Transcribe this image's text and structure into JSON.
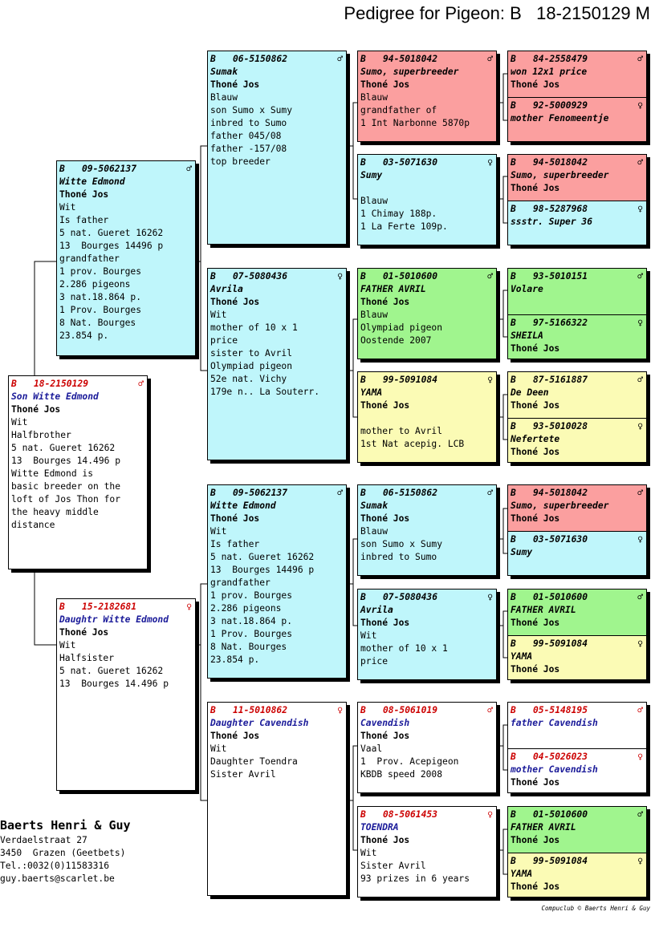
{
  "title": "Pedigree for Pigeon: B   18-2150129 M",
  "subject": {
    "cc": "B",
    "ring": "18-2150129",
    "sex": "♂",
    "name": "Son Witte Edmond",
    "owner": "Thoné Jos",
    "lines": [
      "Wit",
      "Halfbrother",
      "5 nat. Gueret 16262",
      "13  Bourges 14.496 p",
      "Witte Edmond is",
      "basic breeder on the",
      "loft of Jos Thon for",
      "the heavy middle",
      "distance"
    ]
  },
  "sibling": {
    "cc": "B",
    "ring": "15-2182681",
    "sex": "♀",
    "name": "Daughtr Witte Edmond",
    "owner": "Thoné Jos",
    "lines": [
      "Wit",
      "Halfsister",
      "5 nat. Gueret 16262",
      "13  Bourges 14.496 p"
    ]
  },
  "p1": {
    "cc": "B",
    "ring": "09-5062137",
    "sex": "♂",
    "name": "Witte Edmond",
    "owner": "Thoné Jos",
    "lines": [
      "Wit",
      "Is father",
      "5 nat. Gueret 16262",
      "13  Bourges 14496 p",
      "grandfather",
      "1 prov. Bourges",
      "2.286 pigeons",
      "3 nat.18.864 p.",
      "1 Prov. Bourges",
      "8 Nat. Bourges",
      "23.854 p."
    ]
  },
  "gp1": {
    "cc": "B",
    "ring": "06-5150862",
    "sex": "♂",
    "name": "Sumak",
    "owner": "Thoné Jos",
    "lines": [
      "Blauw",
      "son Sumo x Sumy",
      "inbred to Sumo",
      "father 045/08",
      "father -157/08",
      "top breeder"
    ]
  },
  "gp2": {
    "cc": "B",
    "ring": "07-5080436",
    "sex": "♀",
    "name": "Avrila",
    "owner": "Thoné Jos",
    "lines": [
      "Wit",
      "mother of 10 x 1",
      "price",
      "sister to Avril",
      "Olympiad pigeon",
      "52e nat. Vichy",
      "179e n.. La Souterr."
    ]
  },
  "gp3": {
    "cc": "B",
    "ring": "09-5062137",
    "sex": "♂",
    "name": "Witte Edmond",
    "owner": "Thoné Jos",
    "lines": [
      "Wit",
      "Is father",
      "5 nat. Gueret 16262",
      "13  Bourges 14496 p",
      "grandfather",
      "1 prov. Bourges",
      "2.286 pigeons",
      "3 nat.18.864 p.",
      "1 Prov. Bourges",
      "8 Nat. Bourges",
      "23.854 p."
    ]
  },
  "gp4": {
    "cc": "B",
    "ring": "11-5010862",
    "sex": "♀",
    "name": "Daughter Cavendish",
    "owner": "Thoné Jos",
    "lines": [
      "Wit",
      "Daughter Toendra",
      "Sister Avril"
    ]
  },
  "ggp1": {
    "cc": "B",
    "ring": "94-5018042",
    "sex": "♂",
    "name": "Sumo, superbreeder",
    "owner": "Thoné Jos",
    "lines": [
      "Blauw",
      "grandfather of",
      "1 Int Narbonne 5870p"
    ]
  },
  "ggp2": {
    "cc": "B",
    "ring": "03-5071630",
    "sex": "♀",
    "name": "Sumy",
    "owner": "",
    "lines": [
      "Blauw",
      "1 Chimay 188p.",
      "1 La Ferte 109p."
    ]
  },
  "ggp3": {
    "cc": "B",
    "ring": "01-5010600",
    "sex": "♂",
    "name": "FATHER AVRIL",
    "owner": "Thoné Jos",
    "lines": [
      "Blauw",
      "Olympiad pigeon",
      "Oostende 2007"
    ]
  },
  "ggp4": {
    "cc": "B",
    "ring": "99-5091084",
    "sex": "♀",
    "name": "YAMA",
    "owner": "Thoné Jos",
    "lines": [
      "mother to Avril",
      "1st Nat acepig. LCB"
    ]
  },
  "ggp5": {
    "cc": "B",
    "ring": "06-5150862",
    "sex": "♂",
    "name": "Sumak",
    "owner": "Thoné Jos",
    "lines": [
      "Blauw",
      "son Sumo x Sumy",
      "inbred to Sumo"
    ]
  },
  "ggp6": {
    "cc": "B",
    "ring": "07-5080436",
    "sex": "♀",
    "name": "Avrila",
    "owner": "Thoné Jos",
    "lines": [
      "Wit",
      "mother of 10 x 1",
      "price"
    ]
  },
  "ggp7": {
    "cc": "B",
    "ring": "08-5061019",
    "sex": "♂",
    "name": "Cavendish",
    "owner": "Thoné Jos",
    "lines": [
      "Vaal",
      "1  Prov. Acepigeon",
      "KBDB speed 2008"
    ]
  },
  "ggp8": {
    "cc": "B",
    "ring": "08-5061453",
    "sex": "♀",
    "name": "TOENDRA",
    "owner": "Thoné Jos",
    "lines": [
      "Wit",
      "Sister Avril",
      "93 prizes in 6 years"
    ]
  },
  "g5": [
    {
      "cc": "B",
      "ring": "84-2558479",
      "sex": "♂",
      "name": "won 12x1 price",
      "owner": "Thoné Jos"
    },
    {
      "cc": "B",
      "ring": "92-5000929",
      "sex": "♀",
      "name": "mother Fenomeentje",
      "owner": ""
    },
    {
      "cc": "B",
      "ring": "94-5018042",
      "sex": "♂",
      "name": "Sumo, superbreeder",
      "owner": "Thoné Jos"
    },
    {
      "cc": "B",
      "ring": "98-5287968",
      "sex": "♀",
      "name": "ssstr. Super 36",
      "owner": ""
    },
    {
      "cc": "B",
      "ring": "93-5010151",
      "sex": "♂",
      "name": "Volare",
      "owner": ""
    },
    {
      "cc": "B",
      "ring": "97-5166322",
      "sex": "♀",
      "name": "SHEILA",
      "owner": "Thoné Jos"
    },
    {
      "cc": "B",
      "ring": "87-5161887",
      "sex": "♂",
      "name": "De Deen",
      "owner": "Thoné Jos"
    },
    {
      "cc": "B",
      "ring": "93-5010028",
      "sex": "♀",
      "name": "Nefertete",
      "owner": "Thoné Jos"
    },
    {
      "cc": "B",
      "ring": "94-5018042",
      "sex": "♂",
      "name": "Sumo, superbreeder",
      "owner": "Thoné Jos"
    },
    {
      "cc": "B",
      "ring": "03-5071630",
      "sex": "♀",
      "name": "Sumy",
      "owner": ""
    },
    {
      "cc": "B",
      "ring": "01-5010600",
      "sex": "♂",
      "name": "FATHER AVRIL",
      "owner": "Thoné Jos"
    },
    {
      "cc": "B",
      "ring": "99-5091084",
      "sex": "♀",
      "name": "YAMA",
      "owner": "Thoné Jos"
    },
    {
      "cc": "B",
      "ring": "05-5148195",
      "sex": "♂",
      "name": "father Cavendish",
      "owner": ""
    },
    {
      "cc": "B",
      "ring": "04-5026023",
      "sex": "♀",
      "name": "mother Cavendish",
      "owner": "Thoné Jos"
    },
    {
      "cc": "B",
      "ring": "01-5010600",
      "sex": "♂",
      "name": "FATHER AVRIL",
      "owner": "Thoné Jos"
    },
    {
      "cc": "B",
      "ring": "99-5091084",
      "sex": "♀",
      "name": "YAMA",
      "owner": "Thoné Jos"
    }
  ],
  "breeder": {
    "name": "Baerts Henri & Guy",
    "address": "Verdaelstraat 27",
    "city": "3450  Grazen (Geetbets)",
    "phone": "Tel.:0032(0)11583316",
    "email": "guy.baerts@scarlet.be"
  },
  "footer": "Compuclub © Baerts Henri & Guy",
  "colors": {
    "cyan": "#bff6fb",
    "red": "#fb9f9f",
    "green": "#a0f58e",
    "yellow": "#fbfbb5",
    "hen_red": "#cc0000",
    "name_blue": "#1a1a99"
  }
}
